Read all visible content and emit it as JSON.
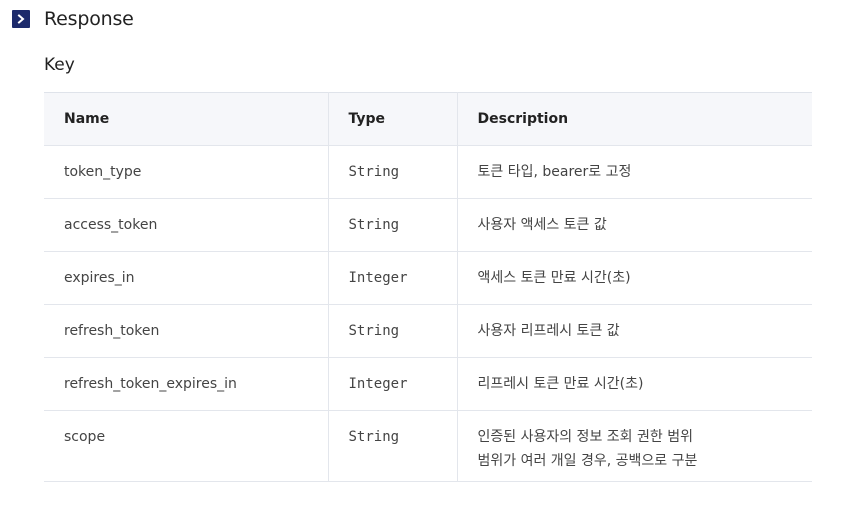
{
  "section": {
    "title": "Response",
    "icon": "chevron-right-icon",
    "accent_color": "#1c2a6b"
  },
  "subsection": {
    "title": "Key"
  },
  "table": {
    "headers": {
      "name": "Name",
      "type": "Type",
      "description": "Description"
    },
    "rows": [
      {
        "name": "token_type",
        "type": "String",
        "description": [
          "토큰 타입, bearer로 고정"
        ]
      },
      {
        "name": "access_token",
        "type": "String",
        "description": [
          "사용자 액세스 토큰 값"
        ]
      },
      {
        "name": "expires_in",
        "type": "Integer",
        "description": [
          "액세스 토큰 만료 시간(초)"
        ]
      },
      {
        "name": "refresh_token",
        "type": "String",
        "description": [
          "사용자 리프레시 토큰 값"
        ]
      },
      {
        "name": "refresh_token_expires_in",
        "type": "Integer",
        "description": [
          "리프레시 토큰 만료 시간(초)"
        ]
      },
      {
        "name": "scope",
        "type": "String",
        "description": [
          "인증된 사용자의 정보 조회 권한 범위",
          "범위가 여러 개일 경우, 공백으로 구분"
        ]
      }
    ]
  }
}
